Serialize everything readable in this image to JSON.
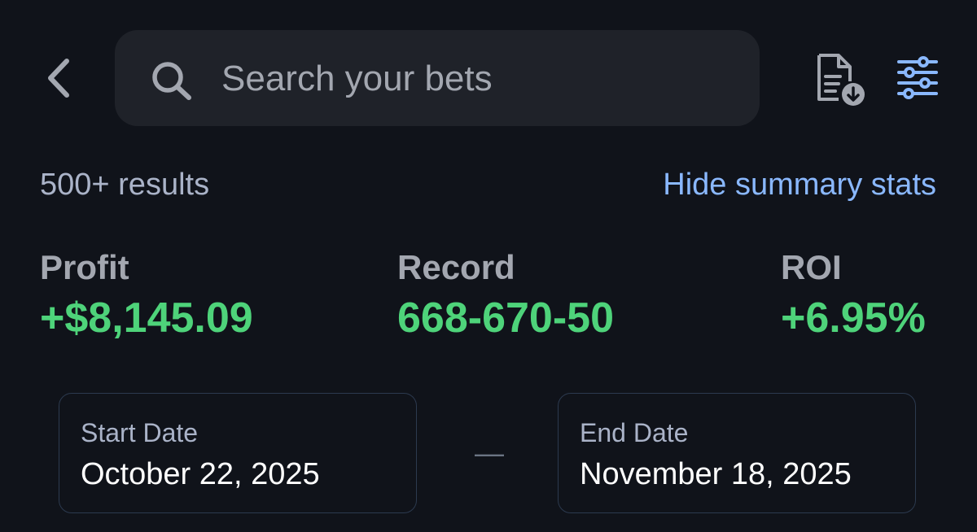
{
  "header": {
    "back_icon": "chevron-left-icon",
    "search": {
      "placeholder": "Search your bets",
      "value": "",
      "icon": "search-icon"
    },
    "export_icon": "document-download-icon",
    "filter_icon": "sliders-icon"
  },
  "summary": {
    "results_count": "500+ results",
    "hide_stats_label": "Hide summary stats"
  },
  "stats": {
    "profit": {
      "label": "Profit",
      "value": "+$8,145.09"
    },
    "record": {
      "label": "Record",
      "value": "668-670-50"
    },
    "roi": {
      "label": "ROI",
      "value": "+6.95%"
    }
  },
  "date_range": {
    "start": {
      "label": "Start Date",
      "value": "October 22, 2025"
    },
    "separator": "—",
    "end": {
      "label": "End Date",
      "value": "November 18, 2025"
    }
  },
  "colors": {
    "background": "#10131a",
    "search_bg": "#1f2229",
    "positive": "#4ed37a",
    "link": "#8ab8ff",
    "muted": "#a3a7b0"
  }
}
